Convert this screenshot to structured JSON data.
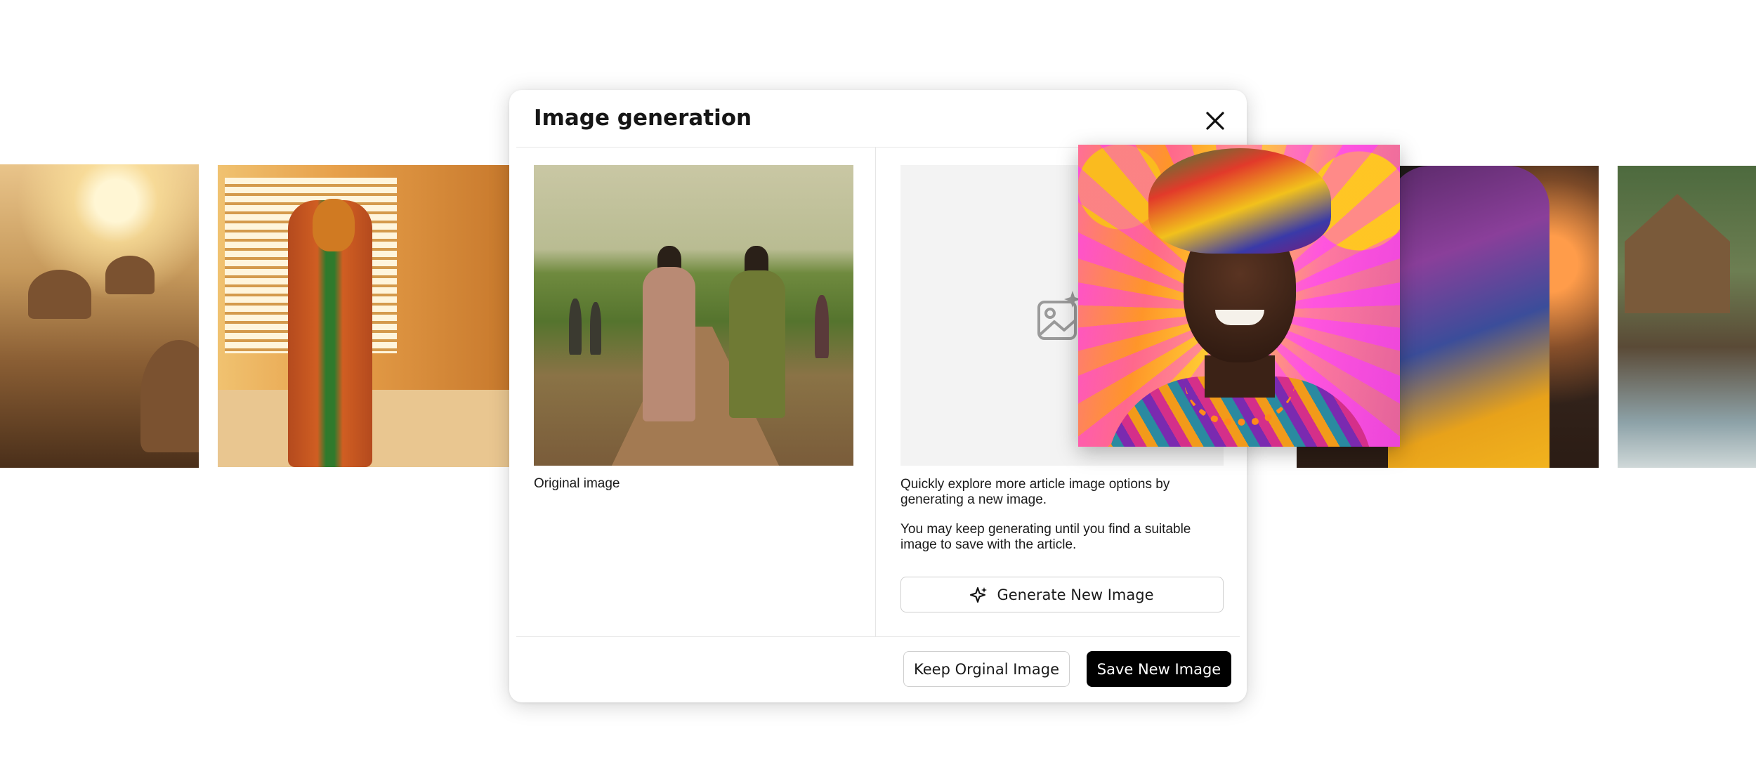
{
  "modal": {
    "title": "Image generation",
    "original_caption": "Original image",
    "description_1": "Quickly explore more article image options by generating a new image.",
    "description_2": "You may keep generating until you find a suitable image to save with the article.",
    "generate_label": "Generate New Image",
    "keep_label": "Keep Orginal Image",
    "save_label": "Save New Image",
    "icons": {
      "close": "close-icon",
      "generate": "sparkle-icon",
      "placeholder": "image-sparkle-icon"
    }
  },
  "colors": {
    "primary_button": "#000000",
    "primary_button_text": "#ffffff",
    "placeholder_bg": "#f3f3f3",
    "divider": "#e6e6e6"
  }
}
